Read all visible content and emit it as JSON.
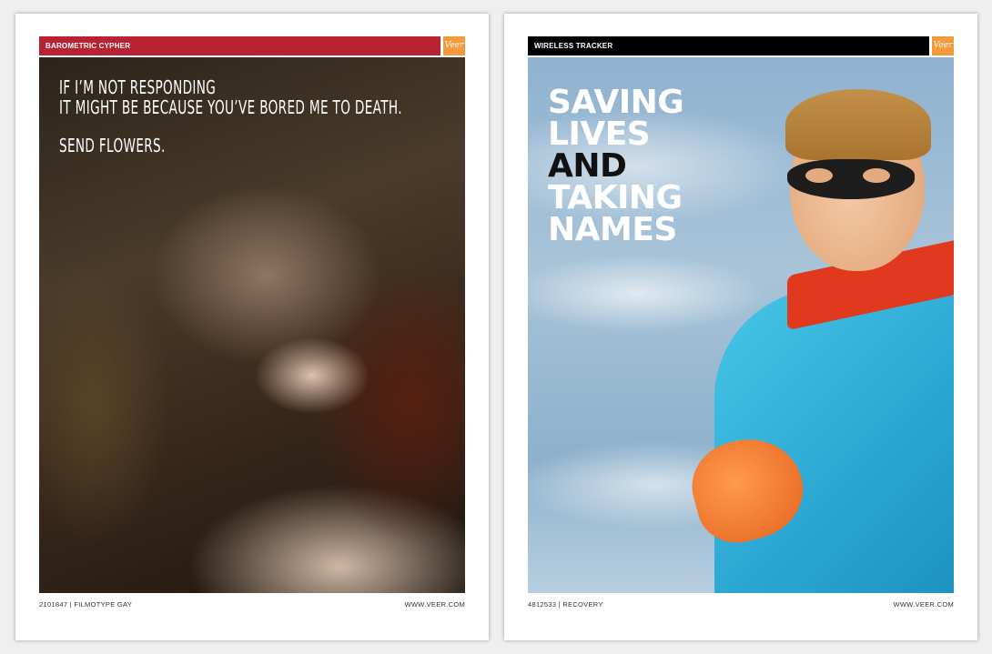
{
  "left_ad": {
    "header_title": "BAROMETRIC CYPHER",
    "header_color": "#b82232",
    "logo_text": "Veer",
    "logo_color": "#f39a3c",
    "quote_line_1": "IF I’M NOT RESPONDING",
    "quote_line_2": "IT MIGHT BE BECAUSE YOU’VE BORED ME TO DEATH.",
    "quote_line_3": "SEND FLOWERS.",
    "footer_left": "2101847  |  FILMOTYPE GAY",
    "footer_right": "WWW.VEER.COM"
  },
  "right_ad": {
    "header_title": "WIRELESS TRACKER",
    "header_color": "#000000",
    "logo_text": "Veer",
    "logo_color": "#f39a3c",
    "headline_1": "SAVING",
    "headline_2": "LIVES",
    "headline_3": "AND",
    "headline_4": "TAKING",
    "headline_5": "NAMES",
    "footer_left": "4812533  |  RECOVERY",
    "footer_right": "WWW.VEER.COM"
  }
}
